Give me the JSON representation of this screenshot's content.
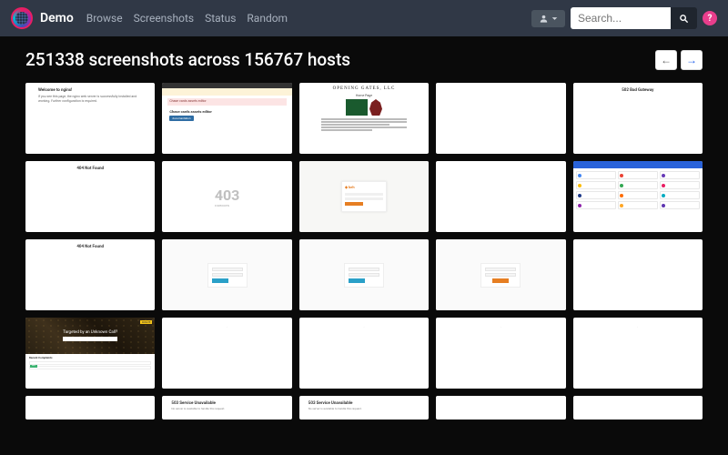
{
  "brand": "Demo",
  "nav": {
    "browse": "Browse",
    "screenshots": "Screenshots",
    "status": "Status",
    "random": "Random"
  },
  "search": {
    "placeholder": "Search..."
  },
  "help": "?",
  "title": "251338 screenshots across 156767 hosts",
  "pager": {
    "prev": "←",
    "next": "→"
  },
  "thumbs": {
    "nginx": {
      "h": "Welcome to nginx!",
      "p": "If you see this page, the nginx web server is successfully installed and working. Further configuration is required."
    },
    "chase": {
      "alert": "Chase cards assets editor",
      "btn": "documentation"
    },
    "company": {
      "name": "OPENING GATES, LLC",
      "sub": "",
      "home": "Home Page"
    },
    "err502": "502 Bad Gateway",
    "err404": "404 Not Found",
    "err403": {
      "code": "403",
      "label": "FORBIDDEN"
    },
    "orange": {
      "logo": "◆ keh"
    },
    "map": {
      "title": "Targeted by an Unknown Call?",
      "badge": "DONATE",
      "recent": "Recent Complaints",
      "tag": "safe"
    },
    "err503": {
      "h": "503 Service Unavailable",
      "p": "No server is available to handle this request."
    }
  }
}
